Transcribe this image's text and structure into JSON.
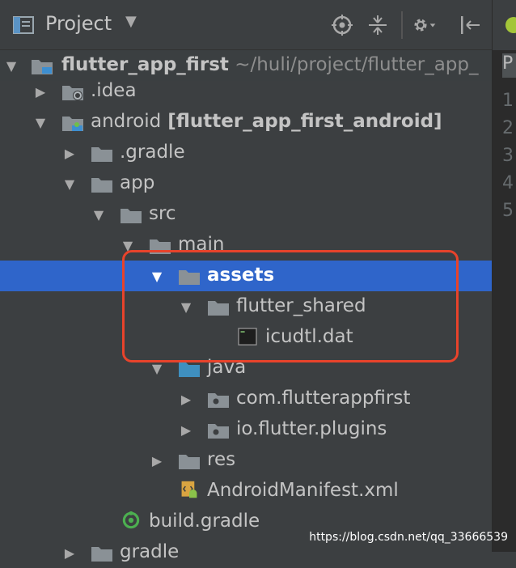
{
  "toolbar": {
    "title": "Project",
    "icons": [
      "project-panel-icon",
      "caret-down-icon",
      "locate-icon",
      "collapse-all-icon",
      "gear-icon",
      "hide-panel-icon"
    ]
  },
  "tree": {
    "rows": [
      {
        "label": "flutter_app_first",
        "suffix": " ~/huli/project/flutter_app_",
        "icon": "module-folder-icon",
        "expanded": true,
        "bold": true
      },
      {
        "label": ".idea",
        "icon": "idea-folder-icon",
        "expanded": false
      },
      {
        "label": "android",
        "suffix": " [flutter_app_first_android]",
        "icon": "android-module-icon",
        "expanded": true
      },
      {
        "label": ".gradle",
        "icon": "folder-icon",
        "expanded": false
      },
      {
        "label": "app",
        "icon": "folder-icon",
        "expanded": true
      },
      {
        "label": "src",
        "icon": "folder-icon",
        "expanded": true
      },
      {
        "label": "main",
        "icon": "folder-icon",
        "expanded": true
      },
      {
        "label": "assets",
        "icon": "folder-icon",
        "expanded": true,
        "selected": true
      },
      {
        "label": "flutter_shared",
        "icon": "folder-icon",
        "expanded": true
      },
      {
        "label": "icudtl.dat",
        "icon": "dat-file-icon"
      },
      {
        "label": "java",
        "icon": "source-folder-icon",
        "expanded": true
      },
      {
        "label": "com.flutterappfirst",
        "icon": "package-icon",
        "expanded": false
      },
      {
        "label": "io.flutter.plugins",
        "icon": "package-icon",
        "expanded": false
      },
      {
        "label": "res",
        "icon": "folder-icon",
        "expanded": false
      },
      {
        "label": "AndroidManifest.xml",
        "icon": "manifest-file-icon"
      },
      {
        "label": "build.gradle",
        "icon": "gradle-file-icon"
      },
      {
        "label": "gradle",
        "icon": "folder-icon",
        "expanded": false
      }
    ]
  },
  "editor": {
    "tab_letter": "P",
    "line_numbers": [
      "1",
      "2",
      "3",
      "4",
      "5"
    ]
  },
  "watermark": "https://blog.csdn.net/qq_33666539",
  "colors": {
    "background": "#3c3f41",
    "selection": "#2f65ca",
    "highlight_box": "#e8432b",
    "folder": "#8a9196",
    "source_folder": "#3f8fbf"
  }
}
